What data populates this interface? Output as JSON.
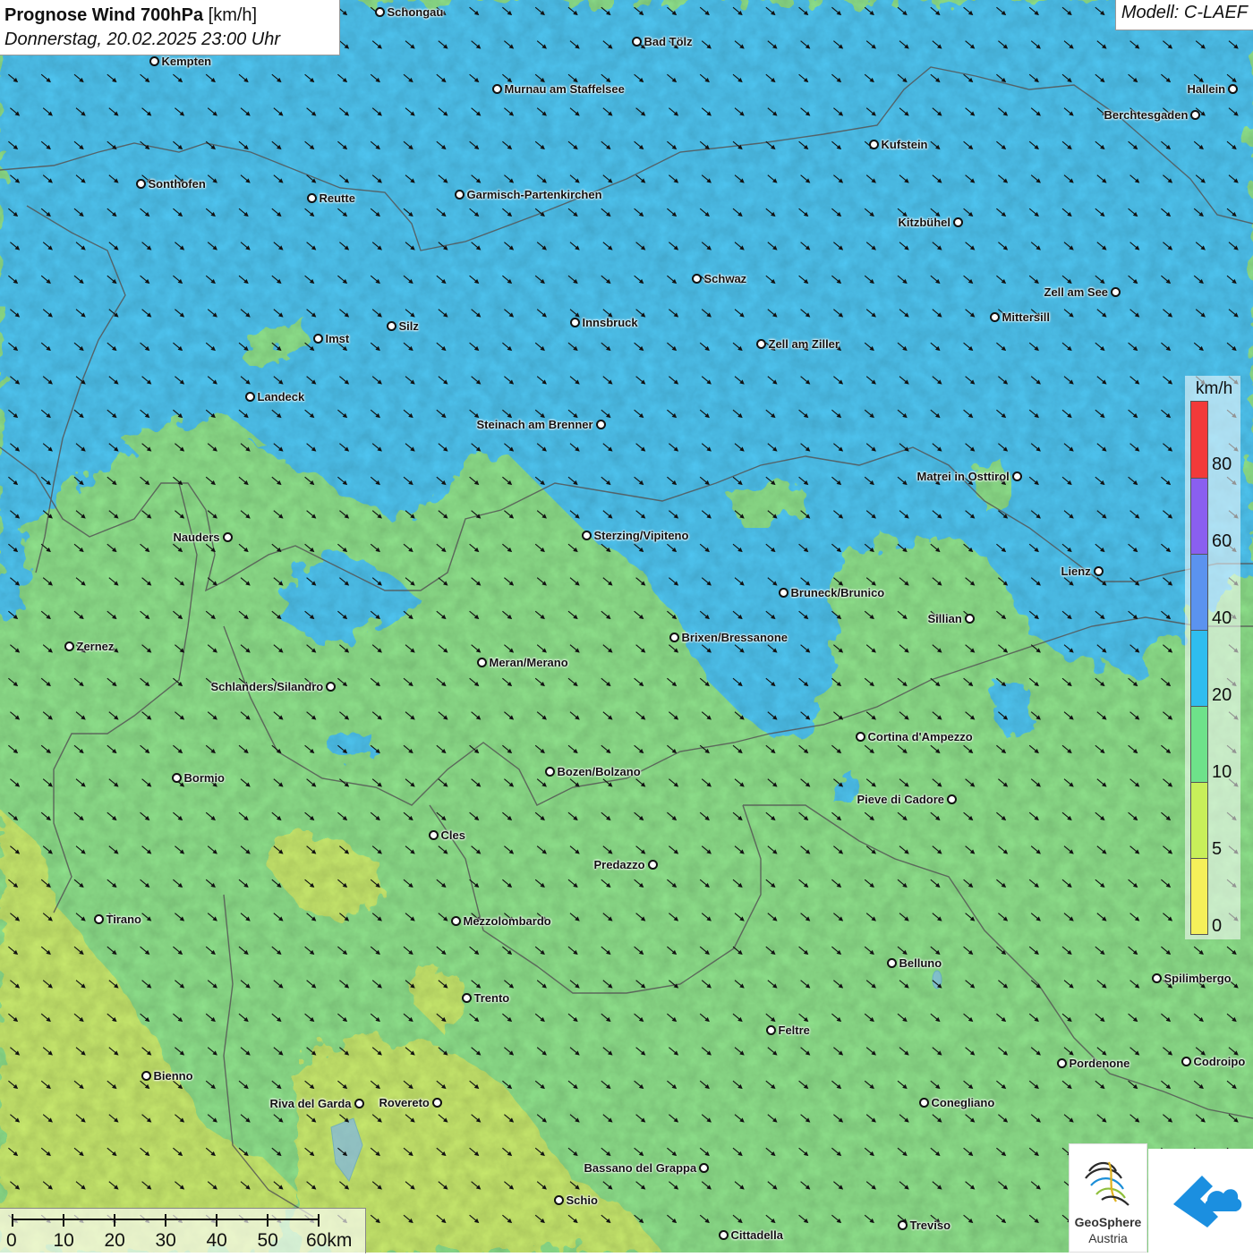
{
  "title": {
    "main": "Prognose Wind 700hPa",
    "unit": "[km/h]",
    "datetime": "Donnerstag, 20.02.2025 23:00 Uhr"
  },
  "model": "Modell: C-LAEF",
  "legend": {
    "unit": "km/h",
    "labels": [
      "80",
      "60",
      "40",
      "20",
      "10",
      "5",
      "0"
    ],
    "colors": [
      "#f23a3a",
      "#8a5ff0",
      "#5b93ef",
      "#2fbdef",
      "#6ee28a",
      "#c8ef5a",
      "#f5f05a"
    ]
  },
  "scalebar": {
    "labels": [
      "0",
      "10",
      "20",
      "30",
      "40",
      "50",
      "60km"
    ]
  },
  "logos": {
    "geosphere_line1": "GeoSphere",
    "geosphere_line2": "Austria"
  },
  "map_colors": {
    "blue_zone": "#4fc6f2",
    "green_zone": "#8fe28c",
    "yellow_zone": "#c9ea6e",
    "arrows": "#111111"
  },
  "wind_direction": "north-west",
  "cities": [
    {
      "name": "Schongau"
    },
    {
      "name": "Bad Tölz"
    },
    {
      "name": "Kempten"
    },
    {
      "name": "Murnau am Staffelsee"
    },
    {
      "name": "Hallein"
    },
    {
      "name": "Berchtesgaden"
    },
    {
      "name": "Kufstein"
    },
    {
      "name": "Sonthofen"
    },
    {
      "name": "Reutte"
    },
    {
      "name": "Garmisch-Partenkirchen"
    },
    {
      "name": "Kitzbühel"
    },
    {
      "name": "Schwaz"
    },
    {
      "name": "Zell am See"
    },
    {
      "name": "Mittersill"
    },
    {
      "name": "Innsbruck"
    },
    {
      "name": "Silz"
    },
    {
      "name": "Imst"
    },
    {
      "name": "Zell am Ziller"
    },
    {
      "name": "Landeck"
    },
    {
      "name": "Steinach am Brenner"
    },
    {
      "name": "Matrei in Osttirol"
    },
    {
      "name": "Nauders"
    },
    {
      "name": "Sterzing/Vipiteno"
    },
    {
      "name": "Lienz"
    },
    {
      "name": "Bruneck/Brunico"
    },
    {
      "name": "Sillian"
    },
    {
      "name": "Brixen/Bressanone"
    },
    {
      "name": "Zernez"
    },
    {
      "name": "Meran/Merano"
    },
    {
      "name": "Schlanders/Silandro"
    },
    {
      "name": "Cortina d'Ampezzo"
    },
    {
      "name": "Bozen/Bolzano"
    },
    {
      "name": "Bormio"
    },
    {
      "name": "Pieve di Cadore"
    },
    {
      "name": "Cles"
    },
    {
      "name": "Predazzo"
    },
    {
      "name": "Tirano"
    },
    {
      "name": "Mezzolombardo"
    },
    {
      "name": "Belluno"
    },
    {
      "name": "Spilimbergo"
    },
    {
      "name": "Trento"
    },
    {
      "name": "Feltre"
    },
    {
      "name": "Pordenone"
    },
    {
      "name": "Codroipo"
    },
    {
      "name": "Bienno"
    },
    {
      "name": "Riva del Garda"
    },
    {
      "name": "Rovereto"
    },
    {
      "name": "Conegliano"
    },
    {
      "name": "Bassano del Grappa"
    },
    {
      "name": "Schio"
    },
    {
      "name": "Treviso"
    },
    {
      "name": "Cittadella"
    }
  ]
}
